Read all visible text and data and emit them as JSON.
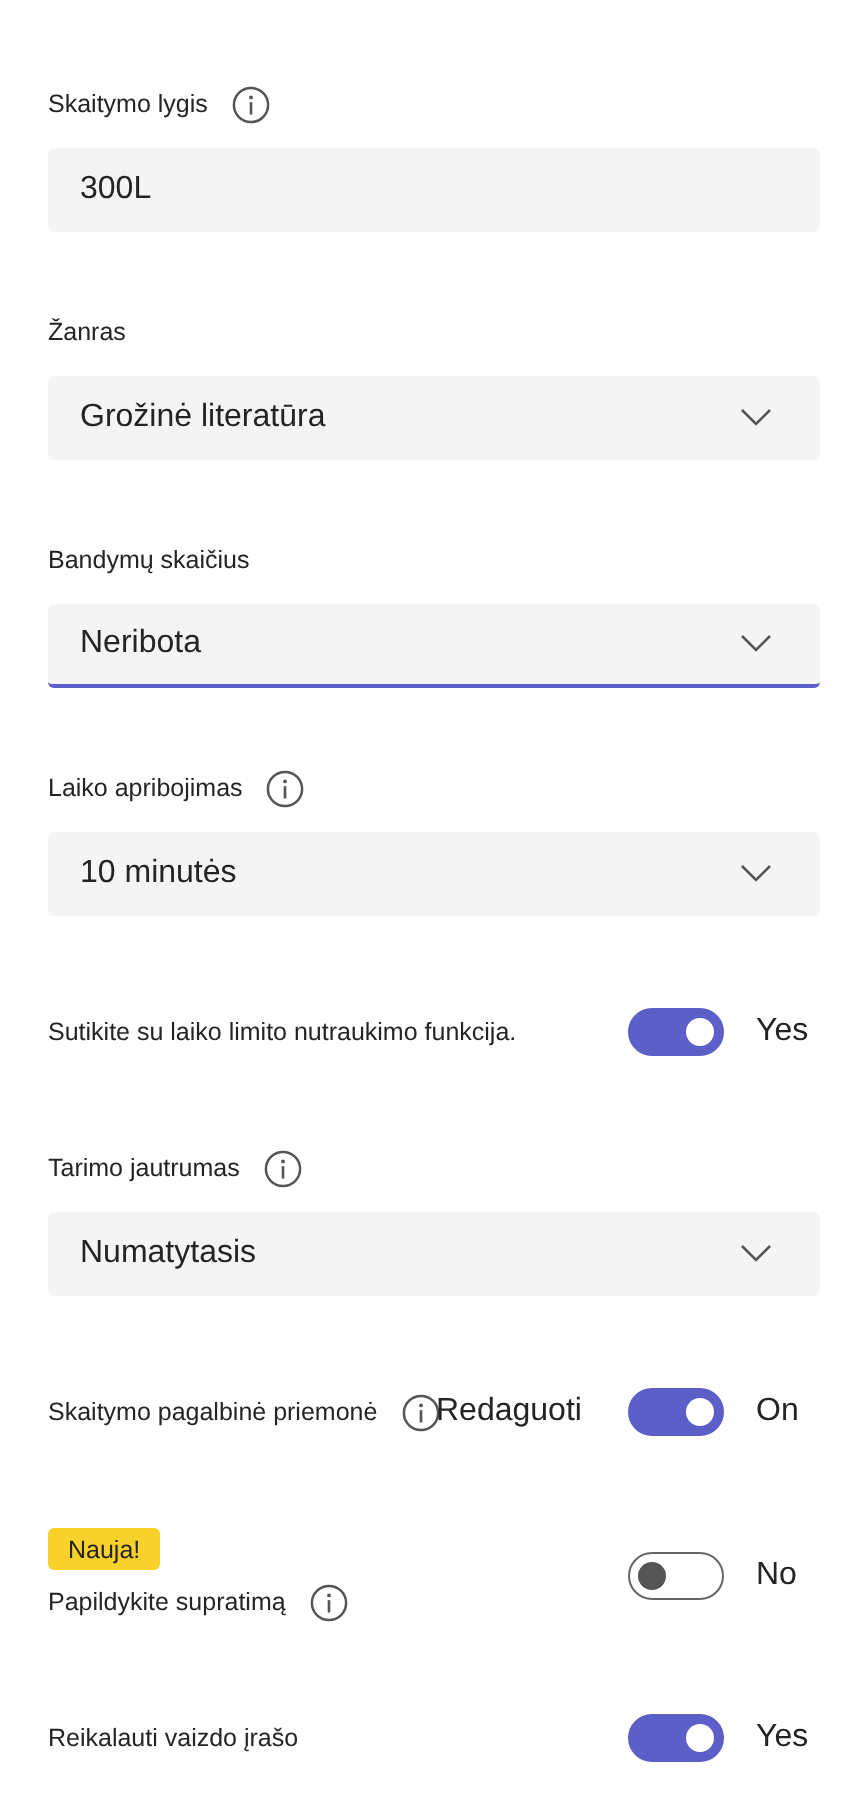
{
  "settings": [
    {
      "kind": "field",
      "label": "Skaitymo lygis",
      "info": true,
      "value": "300L",
      "dropdown": false,
      "focused": false
    },
    {
      "kind": "field",
      "label": "Žanras",
      "info": false,
      "value": "Grožinė literatūra",
      "dropdown": true,
      "focused": false
    },
    {
      "kind": "field",
      "label": "Bandymų skaičius",
      "info": false,
      "value": "Neribota",
      "dropdown": true,
      "focused": true
    },
    {
      "kind": "field",
      "label": "Laiko apribojimas",
      "info": true,
      "value": "10 minutės",
      "dropdown": true,
      "focused": false
    },
    {
      "kind": "toggle",
      "label": "Sutikite su laiko limito nutraukimo funkcija.",
      "info": false,
      "on": true,
      "state": "Yes"
    },
    {
      "kind": "field",
      "label": "Tarimo jautrumas",
      "info": true,
      "value": "Numatytasis",
      "dropdown": true,
      "focused": false
    },
    {
      "kind": "toggle",
      "label": "Skaitymo pagalbinė priemonė",
      "info": true,
      "edit": "Redaguoti",
      "on": true,
      "state": "On"
    },
    {
      "kind": "toggle",
      "label": "Papildykite supratimą",
      "info": true,
      "badge": "Nauja!",
      "on": false,
      "state": "No"
    },
    {
      "kind": "toggle",
      "label": "Reikalauti vaizdo įrašo",
      "info": false,
      "on": true,
      "state": "Yes"
    }
  ]
}
